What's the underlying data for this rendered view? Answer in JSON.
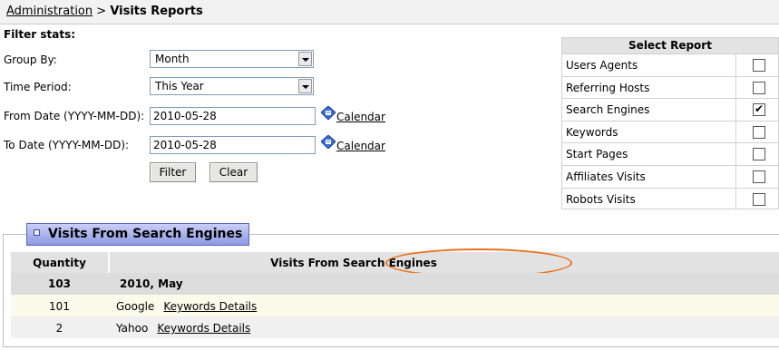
{
  "breadcrumb": {
    "parent": "Administration",
    "separator": ">",
    "current": "Visits Reports"
  },
  "filter": {
    "title": "Filter stats:",
    "group_by": {
      "label": "Group By:",
      "value": "Month"
    },
    "time_period": {
      "label": "Time Period:",
      "value": "This Year"
    },
    "from_date": {
      "label": "From Date (YYYY-MM-DD):",
      "value": "2010-05-28",
      "calendar": "Calendar"
    },
    "to_date": {
      "label": "To Date (YYYY-MM-DD):",
      "value": "2010-05-28",
      "calendar": "Calendar"
    },
    "filter_button": "Filter",
    "clear_button": "Clear"
  },
  "select_report": {
    "title": "Select Report",
    "items": [
      {
        "label": "Users Agents",
        "checked": false
      },
      {
        "label": "Referring Hosts",
        "checked": false
      },
      {
        "label": "Search Engines",
        "checked": true
      },
      {
        "label": "Keywords",
        "checked": false
      },
      {
        "label": "Start Pages",
        "checked": false
      },
      {
        "label": "Affiliates Visits",
        "checked": false
      },
      {
        "label": "Robots Visits",
        "checked": false
      }
    ]
  },
  "results": {
    "tab_title": "Visits From Search Engines",
    "columns": [
      "Quantity",
      "Visits From Search Engines"
    ],
    "group_row": {
      "quantity": "103",
      "period": "2010, May"
    },
    "rows": [
      {
        "quantity": "101",
        "engine": "Google",
        "link": "Keywords Details"
      },
      {
        "quantity": "2",
        "engine": "Yahoo",
        "link": "Keywords Details"
      }
    ]
  },
  "colors": {
    "tab_gradient_top": "#c9cff6",
    "tab_gradient_bottom": "#8e99e3",
    "highlight_ellipse": "#e8731e",
    "group_row_bg": "#dcdcdc",
    "row_odd_bg": "#fbfbeb",
    "row_even_bg": "#f0f0f0"
  }
}
